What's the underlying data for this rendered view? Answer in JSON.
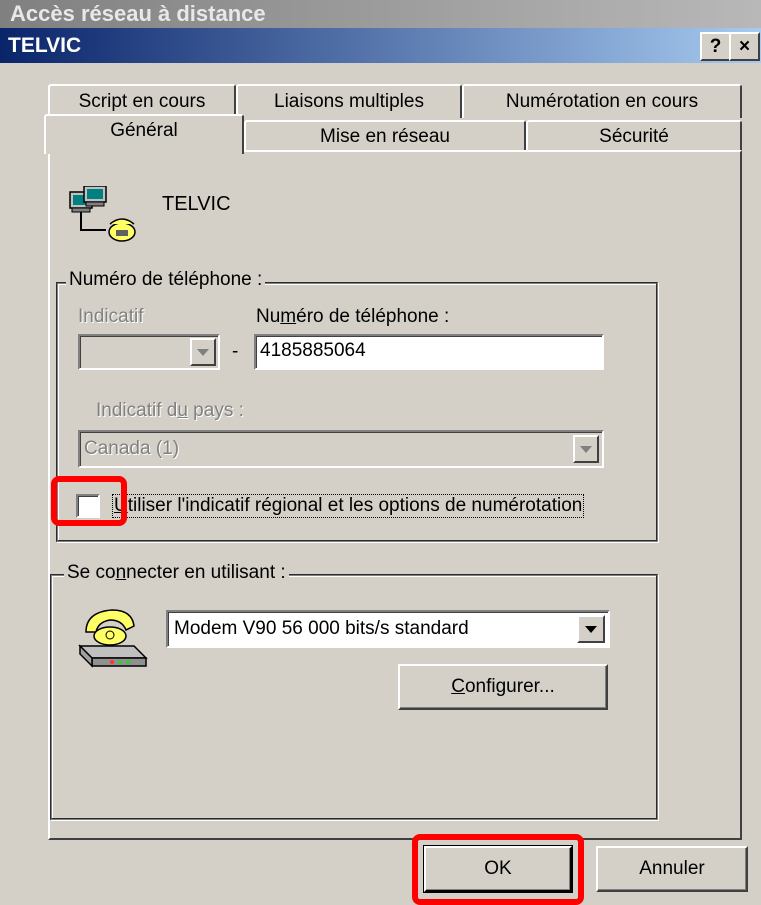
{
  "window": {
    "background_title": "Accès réseau à distance",
    "title": "TELVIC",
    "help_button": "?",
    "close_button": "×"
  },
  "tabs": {
    "row_back": [
      "Script en cours",
      "Liaisons multiples",
      "Numérotation en cours"
    ],
    "row_front": [
      "Général",
      "Mise en réseau",
      "Sécurité"
    ],
    "selected": "Général"
  },
  "connection": {
    "name": "TELVIC",
    "icon": "dialup-connection-icon"
  },
  "phone_group": {
    "legend": "Numéro de téléphone :",
    "area_code_label": "Indicatif",
    "area_code_value": "",
    "separator": "-",
    "phone_label_pre": "Nu",
    "phone_label_accel": "m",
    "phone_label_post": "éro de téléphone :",
    "phone_value": "4185885064",
    "country_label_pre": "Indicatif d",
    "country_label_accel": "u",
    "country_label_post": " pays :",
    "country_value": "Canada (1)",
    "use_dialing_rules_pre": "",
    "use_dialing_rules_accel": "U",
    "use_dialing_rules_post": "tiliser l'indicatif régional et les options de numérotation",
    "use_dialing_rules_checked": false
  },
  "connect_group": {
    "legend_pre": "Se co",
    "legend_accel": "n",
    "legend_post": "necter en utilisant :",
    "modem_value": "Modem V90 56 000 bits/s standard",
    "modem_icon": "modem-phone-icon",
    "configure_pre": "",
    "configure_accel": "C",
    "configure_post": "onfigurer..."
  },
  "buttons": {
    "ok": "OK",
    "cancel": "Annuler"
  },
  "colors": {
    "face": "#d4d0c8",
    "title_active_start": "#0a246a",
    "title_active_end": "#a6caf0",
    "highlight": "#ff0000"
  }
}
